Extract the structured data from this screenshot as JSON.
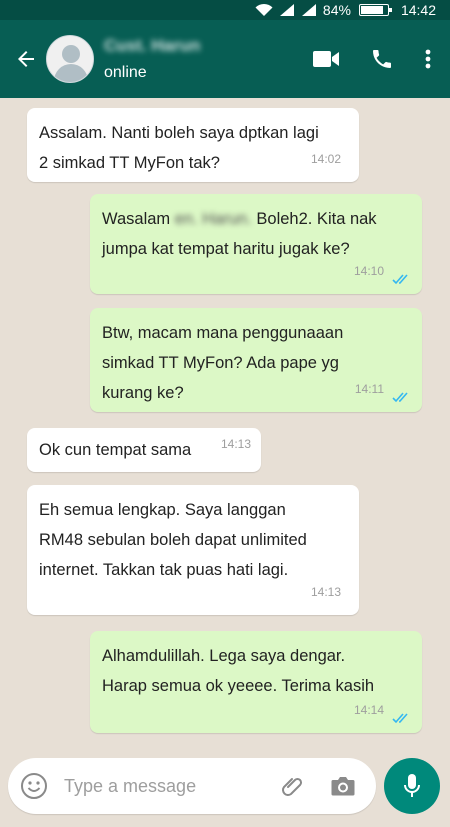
{
  "status_bar": {
    "battery": "84%",
    "time": "14:42"
  },
  "header": {
    "contact_name": "Cust. Harun",
    "presence": "online"
  },
  "messages": [
    {
      "direction": "in",
      "lines": [
        "Assalam. Nanti boleh saya dptkan lagi",
        "2 simkad TT MyFon tak?"
      ],
      "time": "14:02"
    },
    {
      "direction": "out",
      "line1_pre": "Wasalam",
      "line1_blur": "en. Harun.",
      "line1_post": "Boleh2. Kita nak",
      "line2": "jumpa kat tempat haritu jugak ke?",
      "time": "14:10",
      "read": true
    },
    {
      "direction": "out",
      "lines": [
        "Btw, macam mana penggunaaan",
        "simkad TT MyFon? Ada pape yg",
        "kurang ke?"
      ],
      "time": "14:11",
      "read": true
    },
    {
      "direction": "in",
      "lines": [
        "Ok cun tempat sama"
      ],
      "time": "14:13"
    },
    {
      "direction": "in",
      "lines": [
        "Eh semua lengkap. Saya langgan",
        "RM48 sebulan boleh dapat unlimited",
        "internet. Takkan tak puas hati lagi."
      ],
      "time": "14:13"
    },
    {
      "direction": "out",
      "lines": [
        "Alhamdulillah. Lega saya dengar.",
        "Harap semua ok yeeee. Terima kasih"
      ],
      "time": "14:14",
      "read": true
    }
  ],
  "composer": {
    "placeholder": "Type a message"
  },
  "colors": {
    "header": "#075e54",
    "status_bar": "#054d44",
    "outgoing_bubble": "#dcf8c6",
    "incoming_bubble": "#ffffff",
    "mic_button": "#00897b",
    "read_ticks": "#34b7f1"
  },
  "icons": [
    "wifi-icon",
    "signal-icon",
    "battery-icon",
    "back-arrow-icon",
    "video-call-icon",
    "phone-icon",
    "more-vert-icon",
    "emoji-icon",
    "attach-icon",
    "camera-icon",
    "mic-icon",
    "double-tick-icon"
  ]
}
